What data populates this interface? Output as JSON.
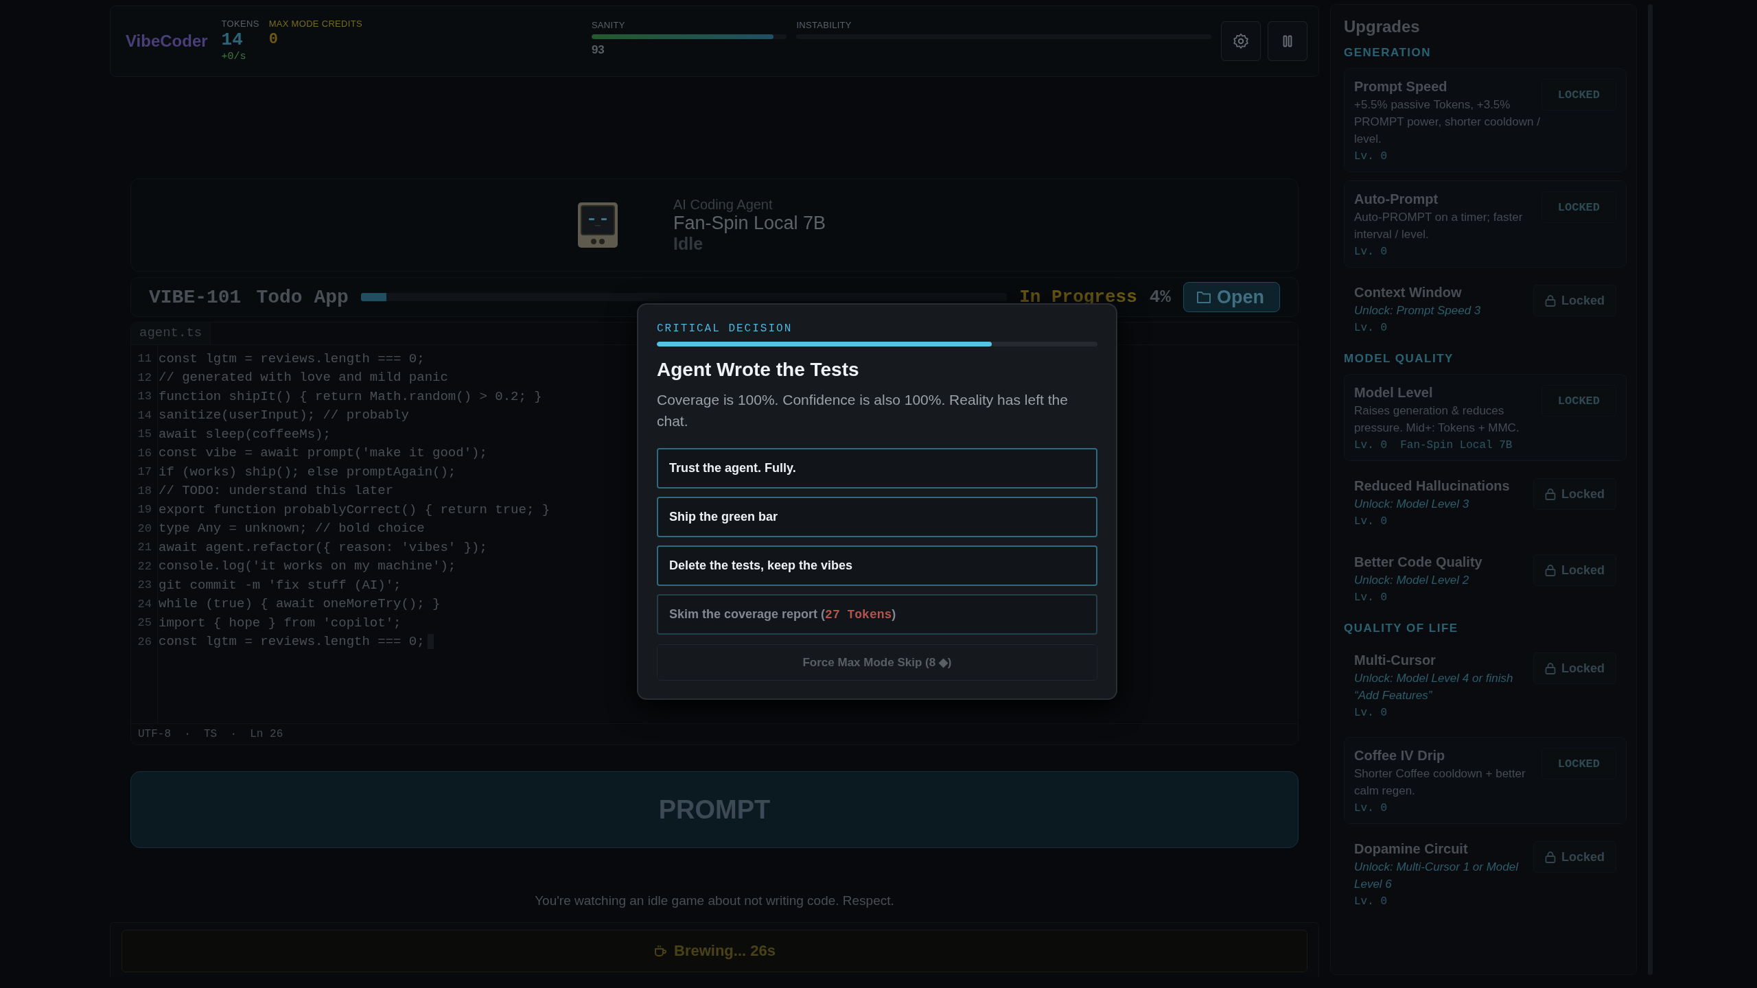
{
  "topbar": {
    "logo": "VibeCoder",
    "stats": [
      {
        "kind": "tokens",
        "label": "TOKENS",
        "value": "14",
        "rate": "+0/s"
      },
      {
        "kind": "credits",
        "label": "MAX MODE CREDITS",
        "value": "0"
      }
    ],
    "meters": [
      {
        "kind": "sanity",
        "label": "SANITY",
        "level": 0.93,
        "reading": "93"
      },
      {
        "kind": "instability",
        "label": "INSTABILITY",
        "level": 0
      }
    ],
    "buttons": [
      {
        "kind": "settings"
      },
      {
        "kind": "pause"
      }
    ]
  },
  "agent": {
    "role": "AI Coding Agent",
    "model": "Fan-Spin Local 7B",
    "status": "Idle"
  },
  "task": {
    "id": "VIBE-101",
    "name": "Todo App",
    "level": 0.04,
    "status": "In Progress",
    "percent": "4%",
    "open_button": "Open"
  },
  "editor": {
    "tab": "agent.ts",
    "lines": [
      {
        "number": "11",
        "code": "const lgtm = reviews.length === 0;"
      },
      {
        "number": "12",
        "code": "// generated with love and mild panic"
      },
      {
        "number": "13",
        "code": "function shipIt() { return Math.random() > 0.2; }"
      },
      {
        "number": "14",
        "code": "sanitize(userInput); // probably"
      },
      {
        "number": "15",
        "code": "await sleep(coffeeMs);"
      },
      {
        "number": "16",
        "code": "const vibe = await prompt('make it good');"
      },
      {
        "number": "17",
        "code": "if (works) ship(); else promptAgain();"
      },
      {
        "number": "18",
        "code": "// TODO: understand this later"
      },
      {
        "number": "19",
        "code": "export function probablyCorrect() { return true; }"
      },
      {
        "number": "20",
        "code": "type Any = unknown; // bold choice"
      },
      {
        "number": "21",
        "code": "await agent.refactor({ reason: 'vibes' });"
      },
      {
        "number": "22",
        "code": "console.log('it works on my machine');"
      },
      {
        "number": "23",
        "code": "git commit -m 'fix stuff (AI)';"
      },
      {
        "number": "24",
        "code": "while (true) { await oneMoreTry(); }"
      },
      {
        "number": "25",
        "code": "import { hope } from 'copilot';"
      },
      {
        "number": "26",
        "code": "const lgtm = reviews.length === 0;"
      }
    ],
    "status": "UTF-8  ·  TS  ·  Ln 26"
  },
  "prompt_button": "PROMPT",
  "footer_note": "You're watching an idle game about not writing code. Respect.",
  "brew_bar": "Brewing... 26s",
  "modal": {
    "eyebrow": "CRITICAL DECISION",
    "timer": {
      "level": 0.76
    },
    "title": "Agent Wrote the Tests",
    "description": "Coverage is 100%. Confidence is also 100%. Reality has left the chat.",
    "options": [
      {
        "label": "Trust the agent. Fully.",
        "disabled": false
      },
      {
        "label": "Ship the green bar",
        "disabled": false
      },
      {
        "label": "Delete the tests, keep the vibes",
        "disabled": false
      },
      {
        "label": "Skim the coverage report (",
        "cost": "27 Tokens",
        "label_end": ")",
        "disabled": true
      }
    ],
    "skip_button": "Force Max Mode Skip (8 ◆)"
  },
  "upgrades": {
    "title": "Upgrades",
    "sections": [
      {
        "title": "GENERATION",
        "items": [
          {
            "kind": "available",
            "name": "Prompt Speed",
            "description": "+5.5% passive Tokens, +3.5% PROMPT power, shorter cooldown / level.",
            "level_text": "Lv. 0",
            "button": "LOCKED"
          },
          {
            "kind": "available",
            "name": "Auto-Prompt",
            "description": "Auto-PROMPT on a timer; faster interval / level.",
            "level_text": "Lv. 0",
            "button": "LOCKED"
          },
          {
            "kind": "locked",
            "name": "Context Window",
            "unlock": "Unlock: Prompt Speed 3",
            "level_text": "Lv. 0",
            "button": "Locked"
          }
        ]
      },
      {
        "title": "MODEL QUALITY",
        "items": [
          {
            "kind": "available",
            "name": "Model Level",
            "description": "Raises generation & reduces pressure. Mid+: Tokens + MMC.",
            "level_text": "Lv. 0",
            "model": "Fan-Spin Local 7B",
            "button": "LOCKED"
          },
          {
            "kind": "locked",
            "name": "Reduced Hallucinations",
            "unlock": "Unlock: Model Level 3",
            "level_text": "Lv. 0",
            "button": "Locked"
          },
          {
            "kind": "locked",
            "name": "Better Code Quality",
            "unlock": "Unlock: Model Level 2",
            "level_text": "Lv. 0",
            "button": "Locked"
          }
        ]
      },
      {
        "title": "QUALITY OF LIFE",
        "items": [
          {
            "kind": "locked",
            "name": "Multi-Cursor",
            "unlock": "Unlock: Model Level 4 or finish “Add Features”",
            "level_text": "Lv. 0",
            "button": "Locked"
          },
          {
            "kind": "available",
            "name": "Coffee IV Drip",
            "description": "Shorter Coffee cooldown + better calm regen.",
            "level_text": "Lv. 0",
            "button": "LOCKED"
          },
          {
            "kind": "locked",
            "name": "Dopamine Circuit",
            "unlock": "Unlock: Multi-Cursor 1 or Model Level 6",
            "level_text": "Lv. 0",
            "button": "Locked"
          }
        ]
      }
    ]
  }
}
